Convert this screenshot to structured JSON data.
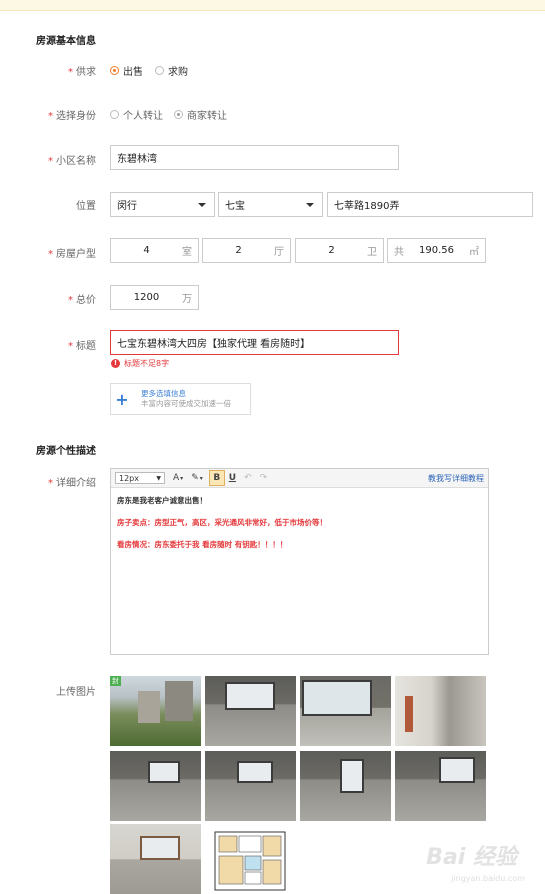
{
  "section_basic": "房源基本信息",
  "supply": {
    "label": "供求",
    "options": [
      "出售",
      "求购"
    ]
  },
  "identity": {
    "label": "选择身份",
    "options": [
      "个人转让",
      "商家转让"
    ]
  },
  "community": {
    "label": "小区名称",
    "value": "东碧林湾"
  },
  "location": {
    "label": "位置",
    "district": "闵行",
    "area": "七宝",
    "address": "七莘路1890弄"
  },
  "layout": {
    "label": "房屋户型",
    "rooms": "4",
    "rooms_unit": "室",
    "halls": "2",
    "halls_unit": "厅",
    "baths": "2",
    "baths_unit": "卫",
    "area_prefix": "共",
    "area": "190.56",
    "area_unit": "㎡"
  },
  "price": {
    "label": "总价",
    "value": "1200",
    "unit": "万"
  },
  "title_field": {
    "label": "标题",
    "value": "七宝东碧林湾大四房【独家代理 看房随时】",
    "error": "标题不足8字"
  },
  "more_options": {
    "line1": "更多选填信息",
    "line2": "丰富内容可使成交加速一倍"
  },
  "section_desc": "房源个性描述",
  "detail": {
    "label": "详细介绍",
    "font_size": "12px",
    "bold_btn": "B",
    "underline_btn": "U",
    "tutorial_link": "教我写详细教程",
    "lines": [
      "房东是我老客户诚意出售！",
      "房子卖点：房型正气，高区，采光通风非常好，低于市场价等！",
      "看房情况：房东委托于我 看房随时 有钥匙！！！！"
    ]
  },
  "upload": {
    "label": "上传图片",
    "cover_tag": "封"
  },
  "watermark": {
    "text": "Bai 经验",
    "url": "jingyan.baidu.com"
  },
  "colors": {
    "accent": "#f07b28",
    "error": "#e4393c",
    "link": "#2b63b7"
  }
}
